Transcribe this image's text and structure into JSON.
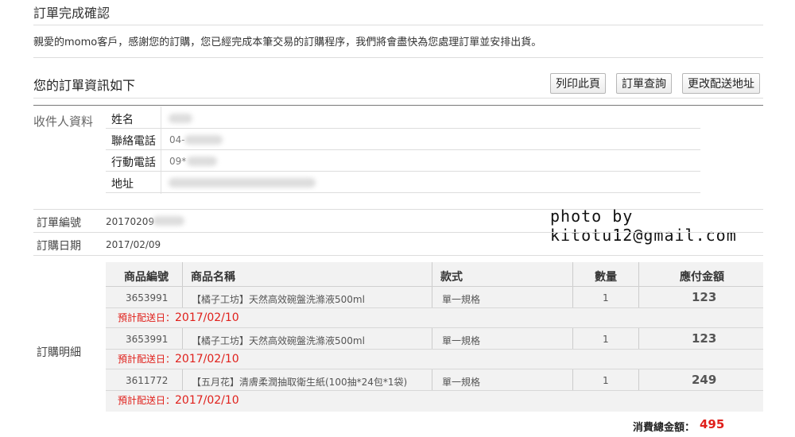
{
  "page": {
    "title": "訂單完成確認",
    "greeting": "親愛的momo客戶，感謝您的訂購，您已經完成本筆交易的訂購程序，我們將會盡快為您處理訂單並安排出貨。",
    "section_title": "您的訂單資訊如下"
  },
  "actions": {
    "print": "列印此頁",
    "query": "訂單查詢",
    "change_address": "更改配送地址"
  },
  "recipient": {
    "label": "收件人資料",
    "name_key": "姓名",
    "phone_key": "聯絡電話",
    "phone_val": "04-",
    "mobile_key": "行動電話",
    "mobile_val": "09*",
    "address_key": "地址"
  },
  "order": {
    "number_key": "訂單編號",
    "number_val": "20170209",
    "date_key": "訂購日期",
    "date_val": "2017/02/09",
    "detail_key": "訂購明細"
  },
  "watermark": "photo by kitotu12@gmail.com",
  "table": {
    "headers": [
      "商品編號",
      "商品名稱",
      "款式",
      "數量",
      "應付金額"
    ],
    "rows": [
      {
        "code": "3653991",
        "name": "【橘子工坊】天然高效碗盤洗滌液500ml",
        "style": "單一規格",
        "qty": "1",
        "amount": "123",
        "ship_label": "預計配送日：",
        "ship_date": "2017/02/10"
      },
      {
        "code": "3653991",
        "name": "【橘子工坊】天然高效碗盤洗滌液500ml",
        "style": "單一規格",
        "qty": "1",
        "amount": "123",
        "ship_label": "預計配送日：",
        "ship_date": "2017/02/10"
      },
      {
        "code": "3611772",
        "name": "【五月花】清膚柔潤抽取衛生紙(100抽*24包*1袋)",
        "style": "單一規格",
        "qty": "1",
        "amount": "249",
        "ship_label": "預計配送日：",
        "ship_date": "2017/02/10"
      }
    ]
  },
  "total": {
    "label": "消費總金額：",
    "value": "495"
  },
  "colors": {
    "accent_red": "#e0201b",
    "table_bg": "#f2f2f2",
    "divider": "#dddddd"
  }
}
